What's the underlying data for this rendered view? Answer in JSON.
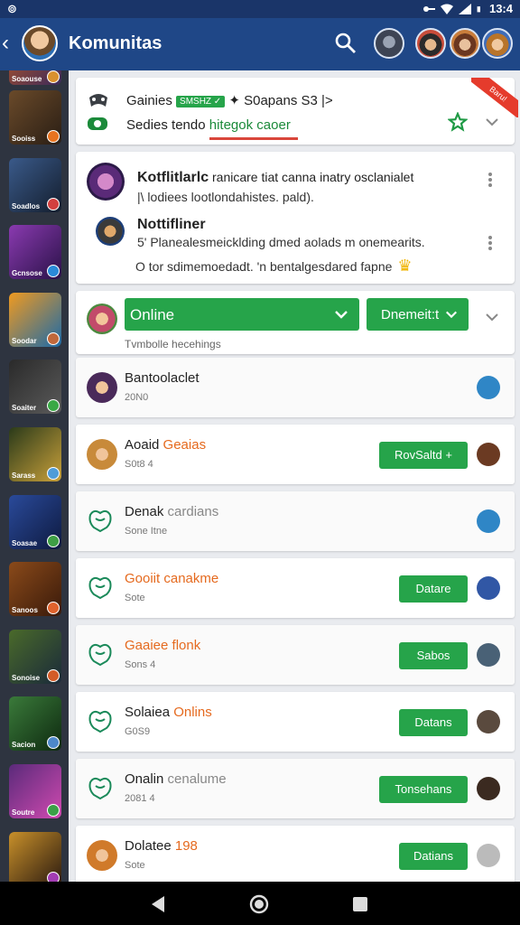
{
  "statusbar": {
    "time": "13:4",
    "left_icon": "app-notification-icon"
  },
  "appbar": {
    "title": "Komunitas",
    "icons": [
      "back-icon",
      "search-icon"
    ]
  },
  "sidebar": {
    "items": [
      {
        "label": "Soaouse",
        "color": "#d9912e"
      },
      {
        "label": "Sooiss",
        "color": "#e8731f"
      },
      {
        "label": "Soadlos",
        "color": "#d23f3f"
      },
      {
        "label": "Gcnsose",
        "color": "#2a8ad8"
      },
      {
        "label": "Soodar",
        "color": "#c0683b"
      },
      {
        "label": "Soaiter",
        "color": "#39a845"
      },
      {
        "label": "Sarass",
        "color": "#4f9cd8"
      },
      {
        "label": "Soasae",
        "color": "#3e9e45"
      },
      {
        "label": "Sanoos",
        "color": "#e0632d"
      },
      {
        "label": "Sonoise",
        "color": "#d35b27"
      },
      {
        "label": "Sacion",
        "color": "#4d88c9"
      },
      {
        "label": "Soutre",
        "color": "#3aa047"
      },
      {
        "label": "",
        "color": "#a33cb3"
      }
    ]
  },
  "top_card": {
    "line1_prefix": "Gainies",
    "line1_pill": "SMSHZ ✓",
    "line1_rest": "✦ S0apans S3 |>",
    "line2_prefix": "Sedies tendo",
    "line2_highlight": "hitegok caoer",
    "ribbon": "Baru!"
  },
  "notifications": [
    {
      "title": "Kotflitlarlc",
      "title_rest": " ranicare tiat canna inatry osclanialet",
      "detail": "|\\ lodiees lootlondahistes. pald)."
    },
    {
      "title": "Nottifliner",
      "detail": "5' Planealesmeicklding dmed aolads m onemearits.",
      "warning": "O   tor sdimemoedadt. 'n bentalgesdared fapne"
    }
  ],
  "status_card": {
    "online_label": "Online",
    "second_label": "Dnemeit:t",
    "sub": "Tvmbolle hecehings"
  },
  "friends": [
    {
      "name": "Bantoolaclet",
      "accent": "",
      "sub": "20N0",
      "button": "",
      "badge": "#2f86c6"
    },
    {
      "name": "Aoaid",
      "accent": "Geaias",
      "sub": "S0t8    4",
      "button": "RovSaltd +",
      "badge": "#6b3a22"
    },
    {
      "name": "Denak",
      "muted": "cardians",
      "sub": "Sone   Itne",
      "button": "",
      "badge": "#2f86c6"
    },
    {
      "name": "",
      "accent": "Gooiit canakme",
      "sub": "Sote",
      "button": "Datare",
      "badge": "#3157a5"
    },
    {
      "name": "",
      "accent": "Gaaiee flonk",
      "sub": "Sons   4",
      "button": "Sabos",
      "badge": "#496176"
    },
    {
      "name": "Solaiea",
      "accent": "Onlins",
      "sub": "G0S9",
      "button": "Datans",
      "badge": "#5a4a3e"
    },
    {
      "name": "Onalin",
      "muted": "cenalume",
      "sub": "2081    4",
      "button": "Tonsehans",
      "badge": "#3b2a20"
    },
    {
      "name": "Dolatee",
      "accent": "198",
      "sub": "Sote",
      "button": "Datians",
      "badge": "#bbbbbb"
    }
  ]
}
